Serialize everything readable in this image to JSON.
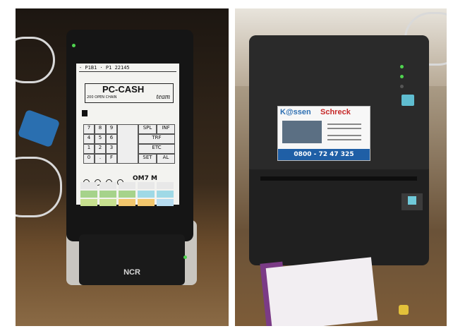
{
  "left_photo": {
    "screen_header": "- P1B1 · P1 22145",
    "logo_brand": "PC-CASH",
    "logo_team": "team",
    "logo_sub": "200 OPEN CHAIN",
    "keypad_keys": [
      "7",
      "8",
      "9",
      "4",
      "5",
      "6",
      "1",
      "2",
      "3",
      "0",
      ".",
      "F",
      "SPL",
      "INF",
      "TRF",
      "ETC",
      "SET",
      "AL"
    ],
    "status_text": "OM7 M",
    "device_brand": "NCR"
  },
  "right_photo": {
    "label_brand_part1": "K@ssen",
    "label_brand_part2": "Schreck",
    "label_phone": "0800 - 72 47 325"
  },
  "colors": {
    "brand_blue": "#2d6fb2",
    "brand_red": "#c62828",
    "led_green": "#4fd44f",
    "printer_button": "#5fbdd0"
  }
}
